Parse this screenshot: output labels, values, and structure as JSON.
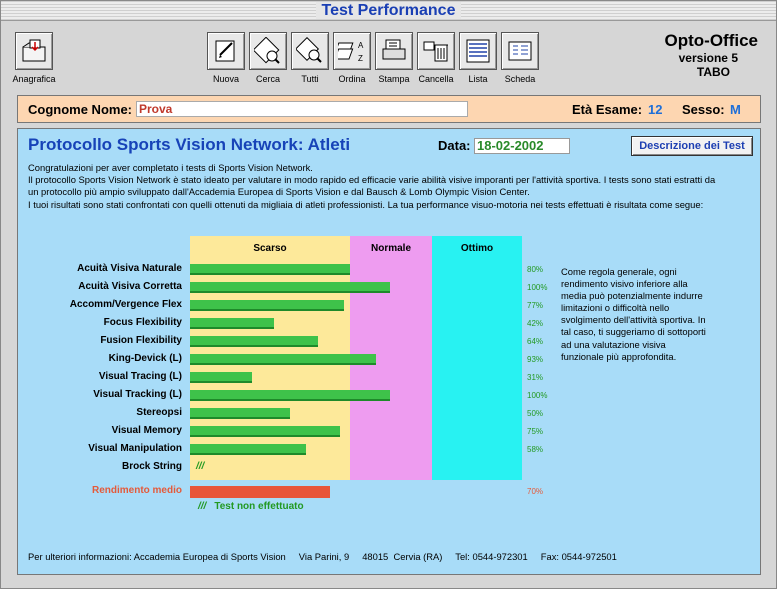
{
  "window": {
    "title": "Test Performance"
  },
  "toolbar": {
    "anagrafica": "Anagrafica",
    "items": [
      {
        "label": "Nuova",
        "icon": "new-record-icon"
      },
      {
        "label": "Cerca",
        "icon": "search-icon"
      },
      {
        "label": "Tutti",
        "icon": "show-all-icon"
      },
      {
        "label": "Ordina",
        "icon": "sort-icon"
      },
      {
        "label": "Stampa",
        "icon": "print-icon"
      },
      {
        "label": "Cancella",
        "icon": "trash-icon"
      },
      {
        "label": "Lista",
        "icon": "list-icon"
      },
      {
        "label": "Scheda",
        "icon": "card-icon"
      }
    ]
  },
  "brand": {
    "name": "Opto-Office",
    "version": "versione 5",
    "sub": "TABO"
  },
  "patient": {
    "name_label": "Cognome Nome:",
    "name_value": "Prova",
    "age_label": "Età Esame:",
    "age_value": "12",
    "sex_label": "Sesso:",
    "sex_value": "M"
  },
  "protocol": {
    "title": "Protocollo Sports Vision Network: Atleti",
    "date_label": "Data:",
    "date_value": "18-02-2002",
    "desc_button": "Descrizione dei Test",
    "intro_lines": [
      "Congratulazioni per aver completato i tests di Sports Vision Network.",
      "Il protocollo Sports Vision Network è stato ideato per valutare in modo rapido ed efficacie varie abilità visive imporanti per l'attività sportiva. I tests sono stati estratti da",
      "un protocollo più ampio sviluppato dall'Accademia Europea di Sports Vision e dal Bausch & Lomb Olympic Vision Center.",
      "I tuoi risultati sono stati confrontati con quelli ottenuti da migliaia di atleti professionisti. La tua performance visuo-motoria nei tests effettuati è risultata come segue:"
    ]
  },
  "chart_data": {
    "type": "bar",
    "zones": [
      {
        "name": "Scarso",
        "color": "#fde99a"
      },
      {
        "name": "Normale",
        "color": "#ee9cf0"
      },
      {
        "name": "Ottimo",
        "color": "#28f2f2"
      }
    ],
    "categories": [
      "Acuità Visiva Naturale",
      "Acuità Visiva Corretta",
      "Accomm/Vergence Flex",
      "Focus Flexibility",
      "Fusion Flexibility",
      "King-Devick (L)",
      "Visual Tracing (L)",
      "Visual Tracking (L)",
      "Stereopsi",
      "Visual Memory",
      "Visual Manipulation",
      "Brock String"
    ],
    "values": [
      80,
      100,
      77,
      42,
      64,
      93,
      31,
      100,
      50,
      75,
      58,
      null
    ],
    "labels": [
      "80%",
      "100%",
      "77%",
      "42%",
      "64%",
      "93%",
      "31%",
      "100%",
      "50%",
      "75%",
      "58%",
      ""
    ],
    "not_done_mark": "///",
    "average": {
      "label": "Rendimento medio",
      "value": 70,
      "text": "70%"
    },
    "bar_color": "#3ec24a",
    "average_color": "#e8553a"
  },
  "legend": {
    "mark": "///",
    "text": "Test non effettuato"
  },
  "note": "Come regola generale, ogni rendimento visivo inferiore alla media può potenzialmente indurre limitazioni o difficoltà nello svolgimento dell'attività sportiva. In tal caso, ti suggeriamo di sottoporti ad una valutazione visiva funzionale più approfondita.",
  "footer": "Per ulteriori informazioni: Accademia Europea di Sports Vision     Via Parini, 9     48015  Cervia (RA)     Tel: 0544-972301     Fax: 0544-972501"
}
